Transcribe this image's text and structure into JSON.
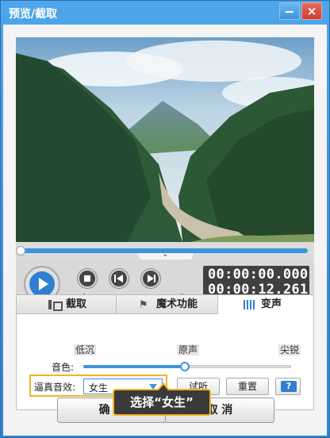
{
  "window": {
    "title": "预览/截取",
    "min_icon": "minimize-icon",
    "close_label": "×"
  },
  "player": {
    "current_time": "00:00:00.000",
    "total_time": "00:00:12.261",
    "progress": 0.0,
    "volume": 1.0
  },
  "tabs": [
    {
      "label": "截取",
      "icon": "crop-icon"
    },
    {
      "label": "魔术功能",
      "icon": "magic-icon"
    },
    {
      "label": "变声",
      "icon": "voice-bars-icon"
    }
  ],
  "voice": {
    "tag_low": "低沉",
    "tag_original": "原声",
    "tag_high": "尖锐",
    "pitch_label": "音色:",
    "pitch_level": 0.5,
    "effect_label": "逼真音效:",
    "effect_value": "女生",
    "try_label": "试听",
    "reset_label": "重置",
    "help_label": "?"
  },
  "footer": {
    "ok_label": "确 定",
    "cancel_label": "取 消"
  },
  "tooltip": {
    "text": "选择“女生”"
  },
  "colors": {
    "accent": "#3c94dd",
    "highlight": "#f2b228",
    "titlebar": "#3a8fd6"
  }
}
